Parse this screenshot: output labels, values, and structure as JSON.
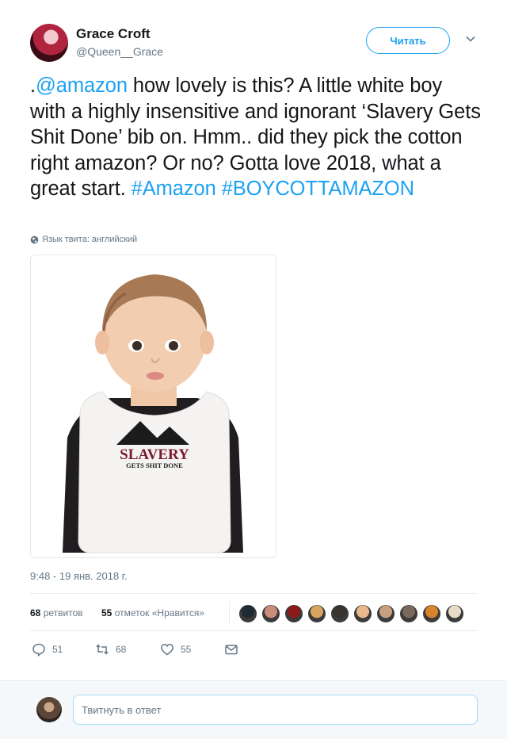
{
  "author": {
    "name": "Grace Croft",
    "handle": "@Queen__Grace"
  },
  "follow_button": {
    "label": "Читать"
  },
  "tweet": {
    "segments": [
      {
        "text": ".",
        "link": false
      },
      {
        "text": "@amazon",
        "link": true
      },
      {
        "text": " how lovely is this? A little white boy with a highly insensitive and ignorant ‘Slavery Gets Shit Done’ bib on. Hmm.. did they pick the cotton right amazon? Or no? Gotta love 2018, what a great start. ",
        "link": false
      },
      {
        "text": "#Amazon",
        "link": true
      },
      {
        "text": " ",
        "link": false
      },
      {
        "text": "#BOYCOTTAMAZON",
        "link": true
      }
    ]
  },
  "language_note": "Язык твита: английский",
  "media": {
    "bib_line1": "SLAVERY",
    "bib_line2": "GETS SHIT DONE"
  },
  "timestamp": "9:48 - 19 янв. 2018 г.",
  "stats": {
    "retweets_count": "68",
    "retweets_label": "ретвитов",
    "likes_count": "55",
    "likes_label": "отметок «Нравится»"
  },
  "liker_avatar_colors": [
    "#1f2a33",
    "#c98c7a",
    "#8b1a1a",
    "#d9a45e",
    "#3a3330",
    "#e8b98a",
    "#c7a07f",
    "#7a6a5e",
    "#d9842b",
    "#e9dcc6"
  ],
  "actions": {
    "replies": "51",
    "retweets": "68",
    "likes": "55"
  },
  "reply_box": {
    "placeholder": "Твитнуть в ответ"
  },
  "colors": {
    "accent": "#1da1f2",
    "muted": "#657786"
  }
}
